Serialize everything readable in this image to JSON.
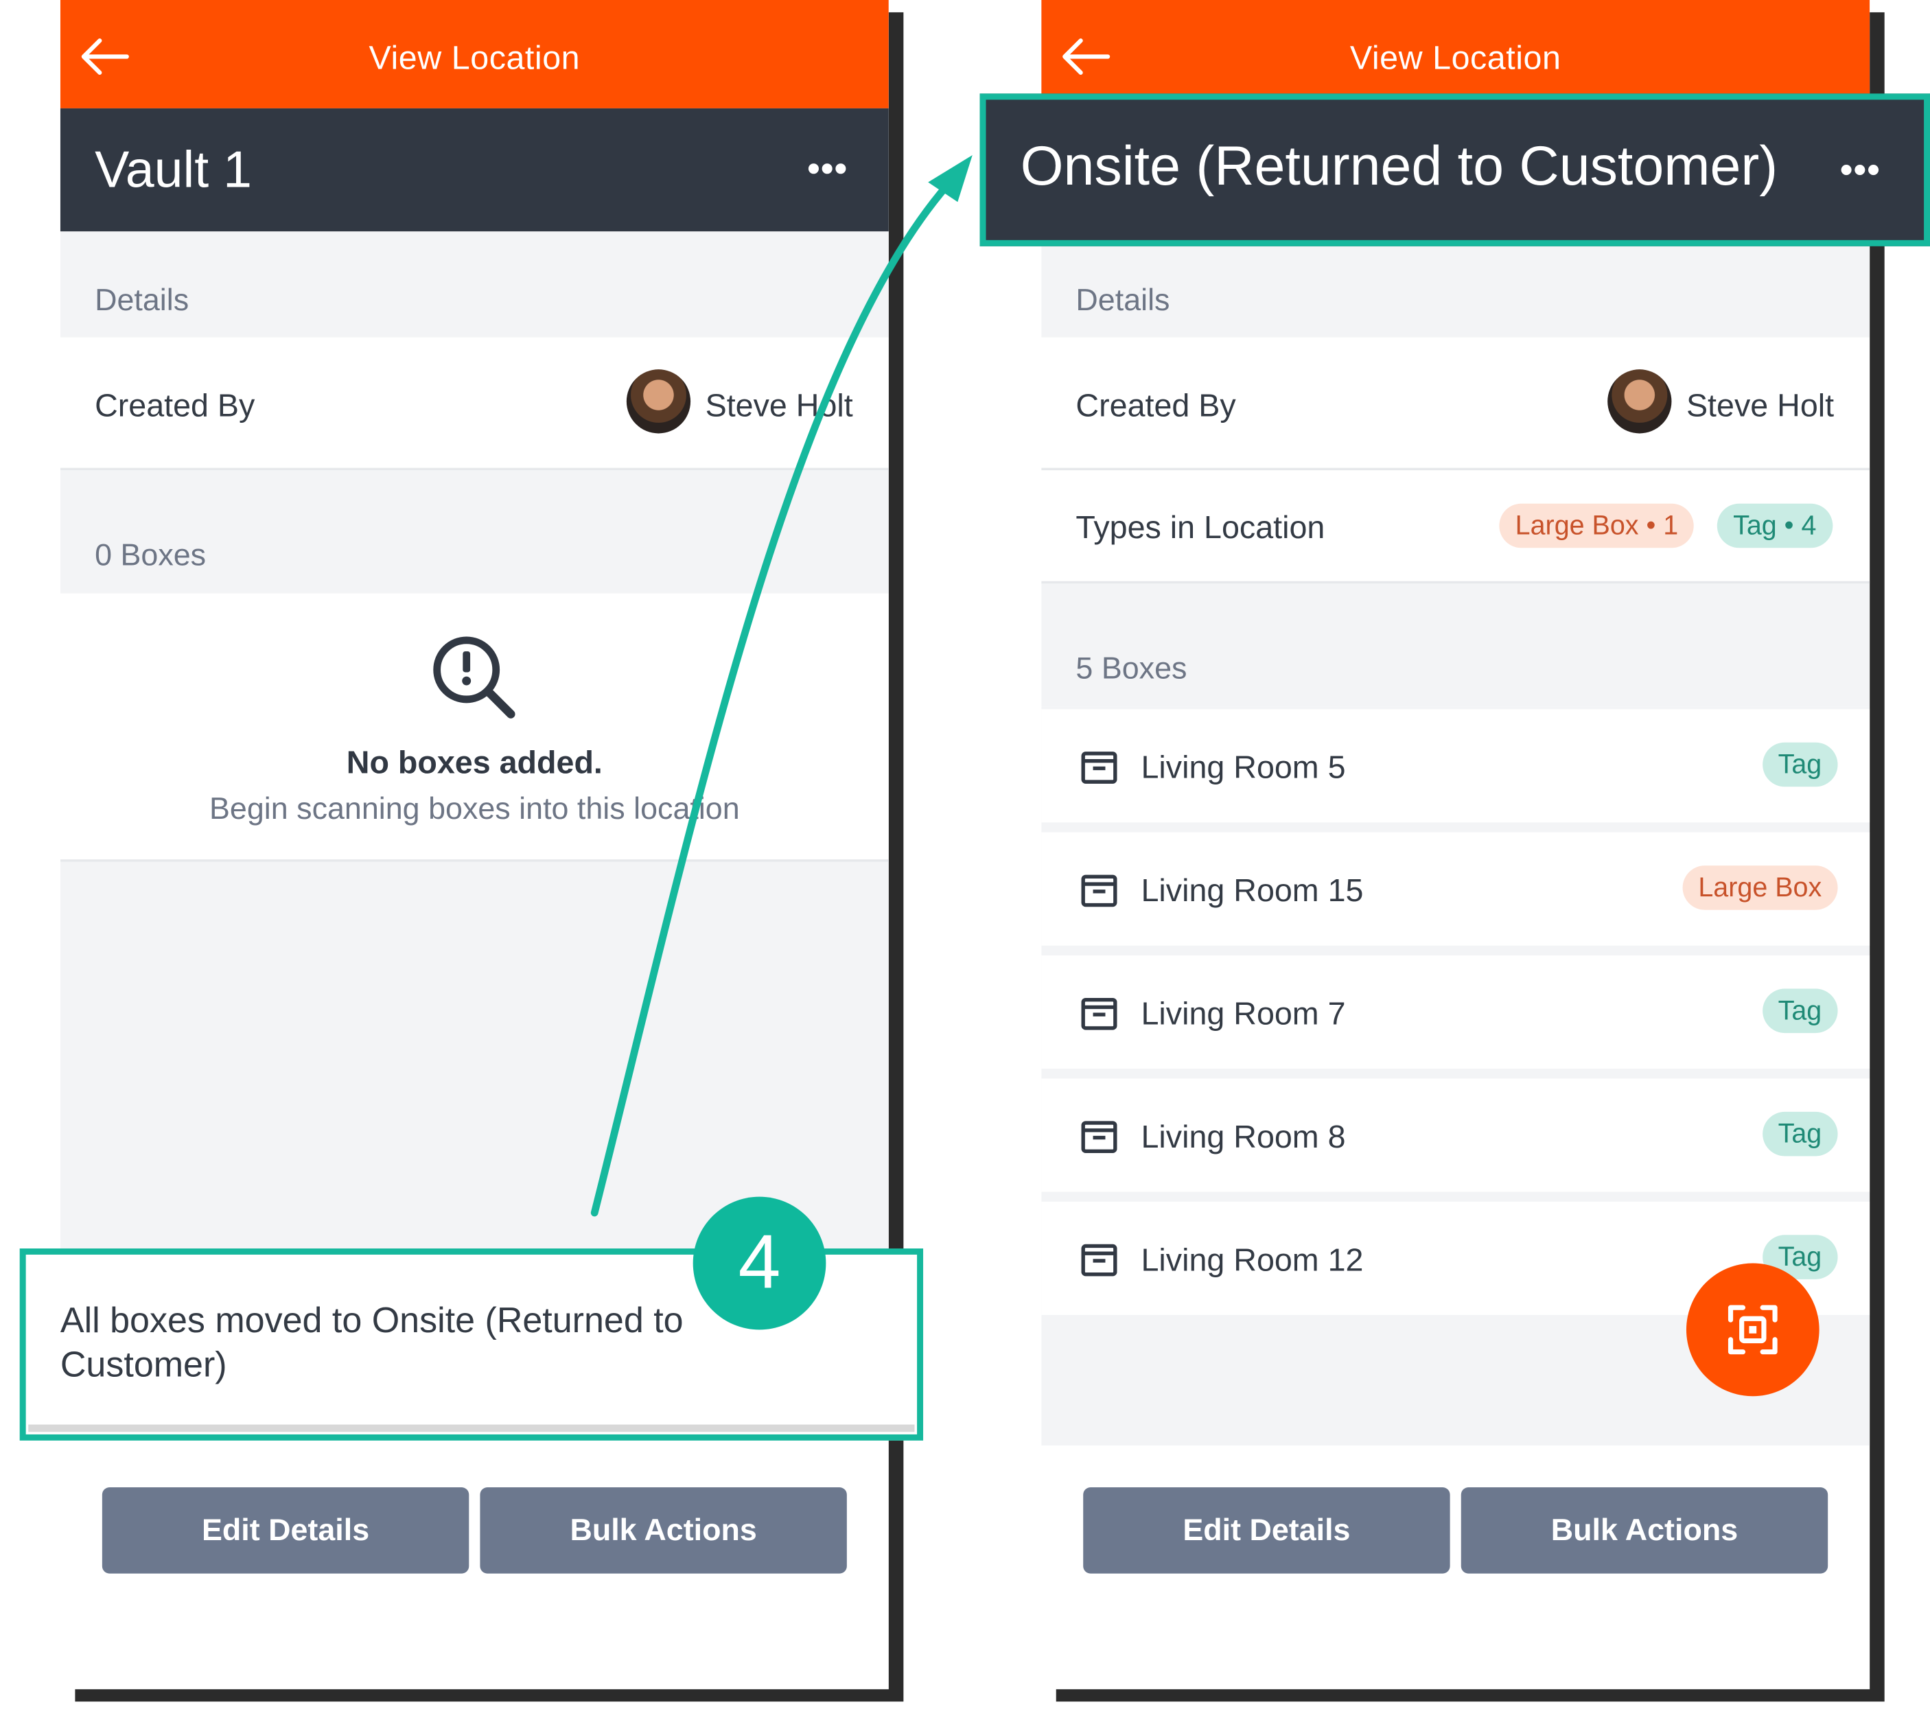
{
  "left": {
    "topbar_title": "View Location",
    "location_name": "Vault 1",
    "details_label": "Details",
    "created_by_label": "Created By",
    "created_by_name": "Steve Holt",
    "boxes_count_label": "0 Boxes",
    "empty_title": "No boxes added.",
    "empty_subtitle": "Begin scanning boxes into this location",
    "toast_message": "All boxes moved to Onsite (Returned to Customer)",
    "edit_button": "Edit Details",
    "bulk_button": "Bulk Actions"
  },
  "right": {
    "topbar_title": "View Location",
    "location_name": "Onsite (Returned to Customer)",
    "details_label": "Details",
    "created_by_label": "Created By",
    "created_by_name": "Steve Holt",
    "types_label": "Types in Location",
    "type_pills": [
      {
        "label": "Large Box • 1",
        "color": "orange"
      },
      {
        "label": "Tag • 4",
        "color": "teal"
      }
    ],
    "boxes_count_label": "5 Boxes",
    "boxes": [
      {
        "name": "Living Room 5",
        "type": "Tag",
        "color": "teal"
      },
      {
        "name": "Living Room 15",
        "type": "Large Box",
        "color": "orange"
      },
      {
        "name": "Living Room 7",
        "type": "Tag",
        "color": "teal"
      },
      {
        "name": "Living Room 8",
        "type": "Tag",
        "color": "teal"
      },
      {
        "name": "Living Room 12",
        "type": "Tag",
        "color": "teal"
      }
    ],
    "edit_button": "Edit Details",
    "bulk_button": "Bulk Actions"
  },
  "annotation": {
    "step_number": "4"
  },
  "colors": {
    "accent_orange": "#ff4f00",
    "header_dark": "#313843",
    "highlight_teal": "#16b89d",
    "button_grey": "#6c788e"
  },
  "icons": [
    "back-arrow-icon",
    "more-options-icon",
    "search-alert-icon",
    "box-icon",
    "scan-icon"
  ]
}
